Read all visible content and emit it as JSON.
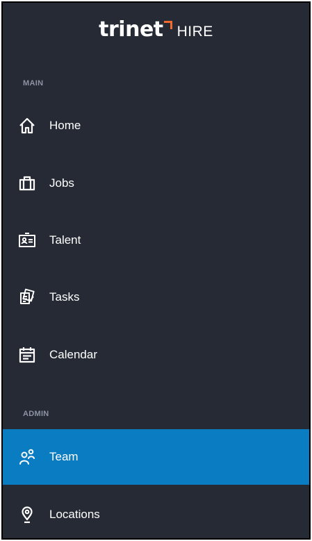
{
  "brand": {
    "logo_word": "trinet",
    "product": "HIRE",
    "accent_color": "#f26a2e"
  },
  "sidebar": {
    "sections": [
      {
        "label": "MAIN",
        "items": [
          {
            "label": "Home",
            "icon": "home-icon"
          },
          {
            "label": "Jobs",
            "icon": "briefcase-icon"
          },
          {
            "label": "Talent",
            "icon": "id-card-icon"
          },
          {
            "label": "Tasks",
            "icon": "task-list-icon"
          },
          {
            "label": "Calendar",
            "icon": "calendar-icon"
          }
        ]
      },
      {
        "label": "ADMIN",
        "items": [
          {
            "label": "Team",
            "icon": "team-icon",
            "active": true
          },
          {
            "label": "Locations",
            "icon": "location-pin-icon"
          }
        ]
      }
    ],
    "background_color": "#262a35",
    "active_color": "#0a7cc2"
  }
}
